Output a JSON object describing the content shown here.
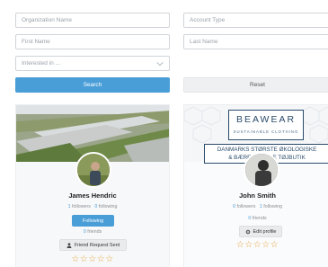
{
  "filters": {
    "organization_placeholder": "Organization Name",
    "account_type_placeholder": "Account Type",
    "first_name_placeholder": "First Name",
    "last_name_placeholder": "Last Name",
    "interest_placeholder": "Interested in ..."
  },
  "actions": {
    "search_label": "Search",
    "reset_label": "Reset"
  },
  "colors": {
    "accent": "#4a9ed8",
    "star": "#e9a13b",
    "brand": "#2a4a6a"
  },
  "profiles": [
    {
      "name": "James Hendric",
      "followers_count": "1",
      "followers_label": "followers",
      "following_count": "0",
      "following_label": "following",
      "primary_action": "Following",
      "friends_count": "0",
      "friends_label": "friends",
      "secondary_action": "Friend Request Sent",
      "secondary_icon": "user-icon",
      "rating": "☆☆☆☆☆"
    },
    {
      "name": "John Smith",
      "followers_count": "0",
      "followers_label": "followers",
      "following_count": "1",
      "following_label": "following",
      "friends_count": "0",
      "friends_label": "friends",
      "secondary_action": "Edit profile",
      "secondary_icon": "gear-icon",
      "rating": "☆☆☆☆☆",
      "cover": {
        "brand_name": "BEAWEAR",
        "brand_tagline": "SUSTAINABLE CLOTHING",
        "banner_line1": "DANMARKS STØRSTE ØKOLOGISKE",
        "banner_line2": "& BÆREDYGTIGE TØJBUTIK"
      }
    }
  ]
}
